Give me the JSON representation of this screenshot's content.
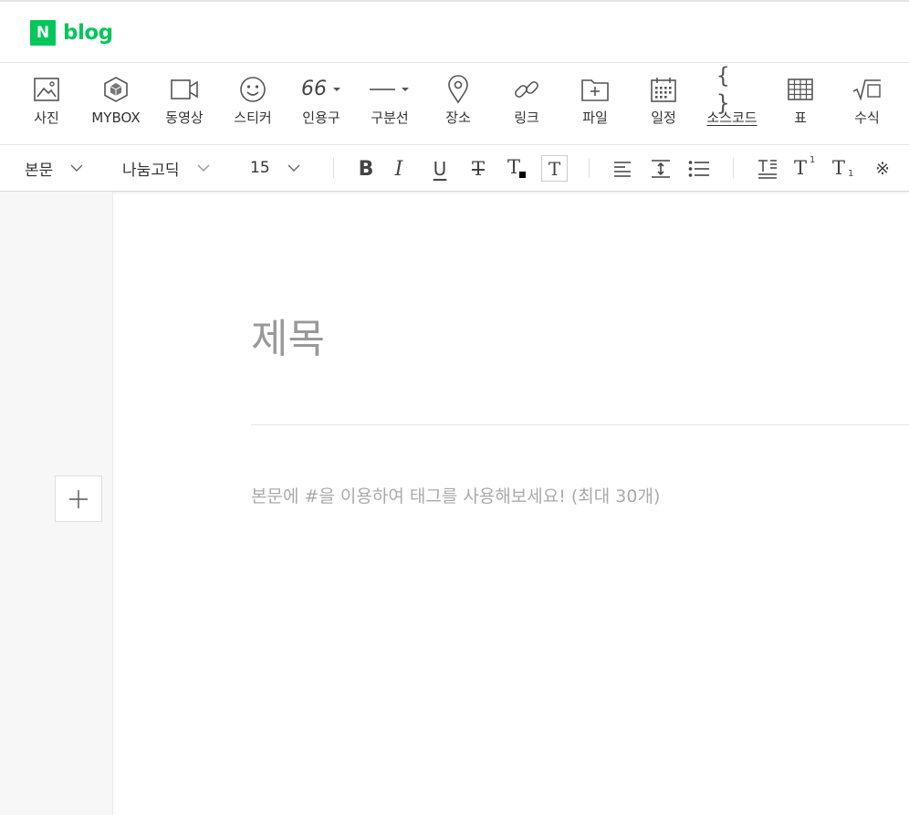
{
  "header": {
    "logo_letter": "N",
    "logo_text": "blog"
  },
  "insert_toolbar": {
    "photo": "사진",
    "mybox": "MYBOX",
    "video": "동영상",
    "sticker": "스티커",
    "quote_glyph": "66",
    "quote": "인용구",
    "divider": "구분선",
    "place": "장소",
    "link": "링크",
    "file": "파일",
    "schedule": "일정",
    "source_code_glyph": "{ }",
    "source_code": "소스코드",
    "table": "표",
    "formula": "수식"
  },
  "format_toolbar": {
    "paragraph_style": "본문",
    "font_family": "나눔고딕",
    "font_size": "15",
    "bold_glyph": "B",
    "italic_glyph": "I",
    "underline_glyph": "U",
    "strike_glyph": "T",
    "text_color_glyph": "T",
    "bg_color_glyph": "T",
    "super_glyph": "T",
    "super_index": "1",
    "sub_glyph": "T",
    "sub_index": "1",
    "special_char_glyph": "※"
  },
  "editor": {
    "title_placeholder": "제목",
    "body_placeholder": "본문에 #을 이용하여 태그를 사용해보세요! (최대 30개)"
  },
  "colors": {
    "brand": "#03c75a",
    "icon": "#555555",
    "placeholder": "#999999"
  }
}
